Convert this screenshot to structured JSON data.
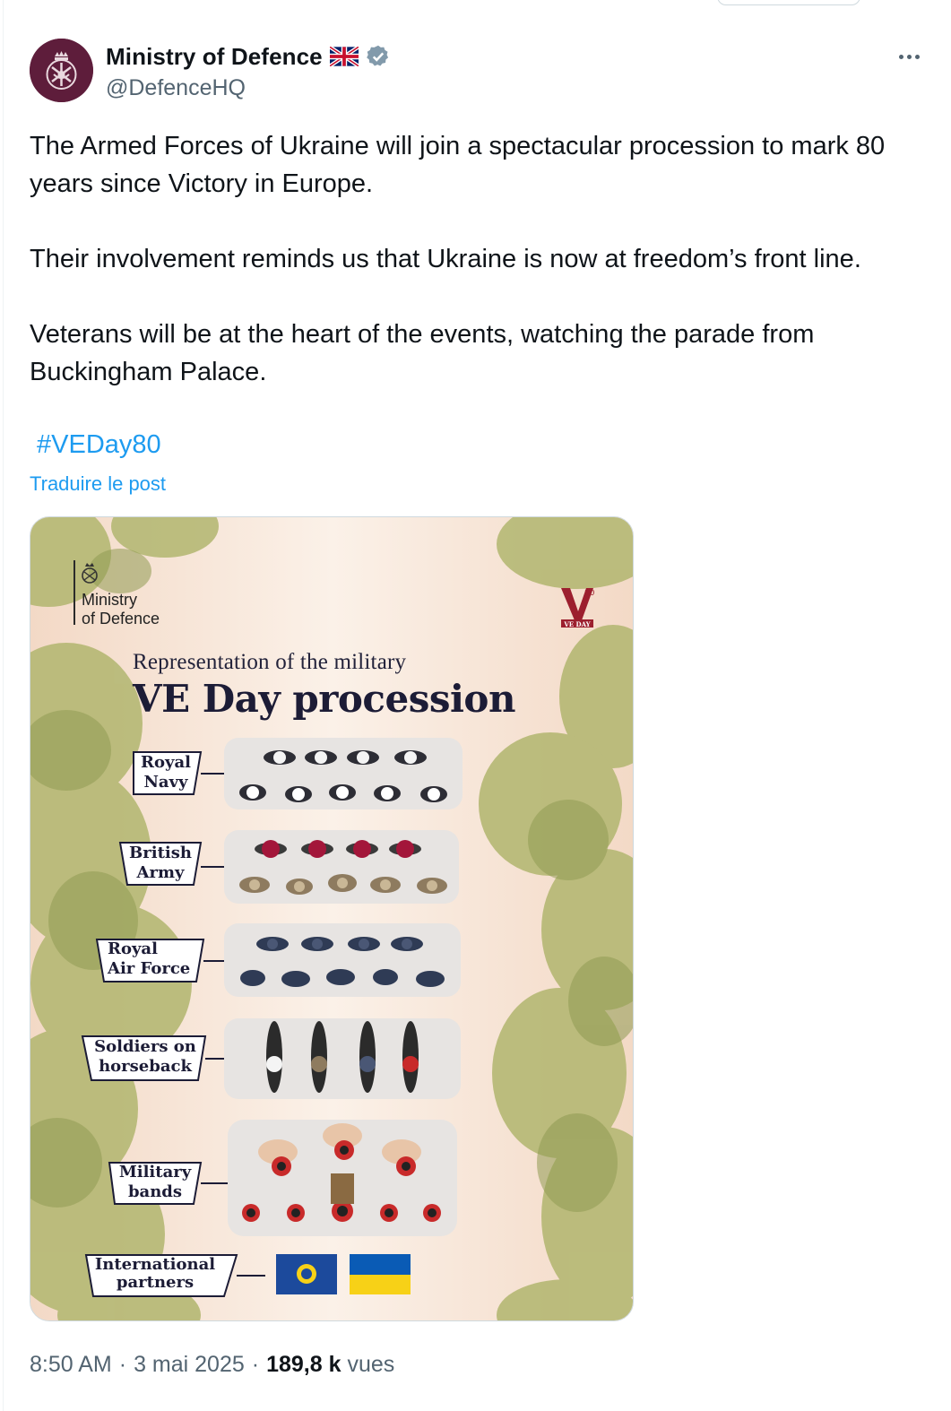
{
  "author": {
    "display_name": "Ministry of Defence",
    "handle": "@DefenceHQ",
    "avatar_icon": "mod-crest-icon",
    "flag_icon": "union-jack-flag-icon",
    "verified_icon": "verified-badge-icon",
    "more_icon": "more-options-icon"
  },
  "tweet": {
    "paragraphs": [
      "The Armed Forces of Ukraine will join a spectacular procession to mark 80 years since Victory in Europe.",
      "Their involvement reminds us that Ukraine is now at freedom’s front line.",
      "Veterans will be at the heart of the events, watching the parade from Buckingham Palace."
    ],
    "hashtag": "#VEDay80",
    "translate_label": "Traduire le post"
  },
  "infographic": {
    "logo_text_line1": "Ministry",
    "logo_text_line2": "of Defence",
    "ve_logo_number": "80",
    "ve_logo_text": "VE DAY",
    "subtitle": "Representation of the military",
    "title": "VE Day procession",
    "units": [
      {
        "line1": "Royal",
        "line2": "Navy"
      },
      {
        "line1": "British",
        "line2": "Army"
      },
      {
        "line1": "Royal",
        "line2": "Air Force"
      },
      {
        "line1": "Soldiers on",
        "line2": "horseback"
      },
      {
        "line1": "Military",
        "line2": "bands"
      },
      {
        "line1": "International",
        "line2": "partners"
      }
    ],
    "colors": {
      "navy_white": "#f4f4f4",
      "army_beret": "#a3163a",
      "army_khaki": "#8e7b5f",
      "raf_blue": "#2f3b55",
      "band_red": "#c82a2a",
      "commonwealth_blue": "#1c4a9c",
      "ukraine_blue": "#0a5bb5",
      "ukraine_yellow": "#f7d117",
      "foliage": "#b5b874"
    }
  },
  "meta": {
    "time": "8:50 AM",
    "separator": "·",
    "date": "3 mai 2025",
    "views_count": "189,8 k",
    "views_label": "vues"
  }
}
